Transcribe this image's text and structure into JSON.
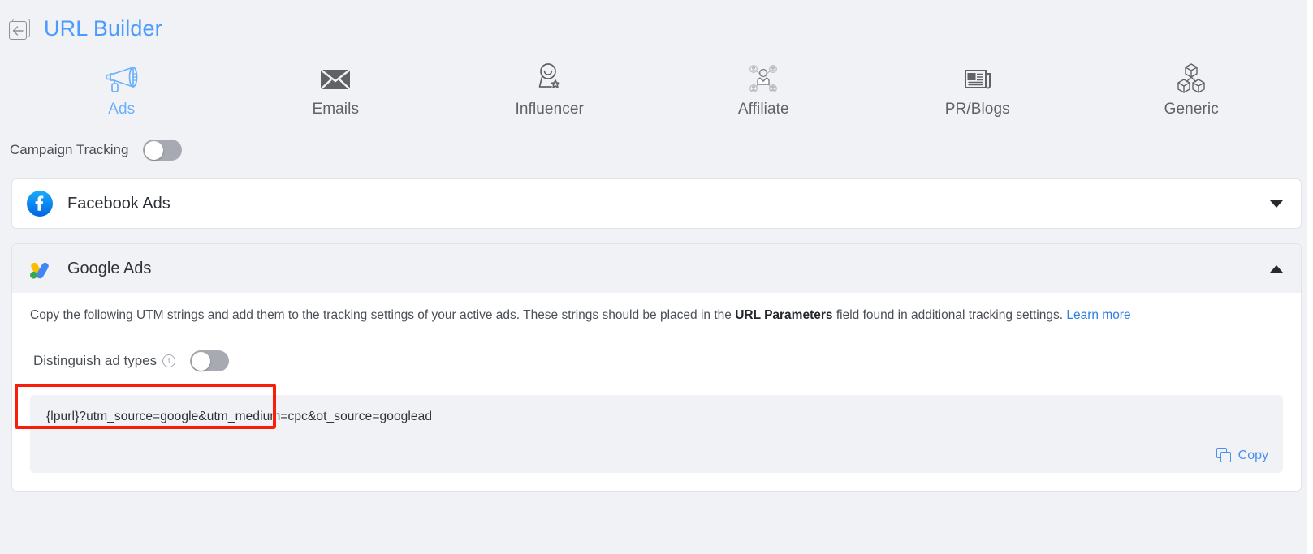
{
  "header": {
    "back_icon": "back-arrow-icon",
    "title": "URL Builder"
  },
  "tabs": [
    {
      "label": "Ads",
      "icon": "megaphone-icon",
      "active": true
    },
    {
      "label": "Emails",
      "icon": "envelope-icon",
      "active": false
    },
    {
      "label": "Influencer",
      "icon": "influencer-person-star-icon",
      "active": false
    },
    {
      "label": "Affiliate",
      "icon": "affiliate-network-icon",
      "active": false
    },
    {
      "label": "PR/Blogs",
      "icon": "newspaper-icon",
      "active": false
    },
    {
      "label": "Generic",
      "icon": "cubes-icon",
      "active": false
    }
  ],
  "campaign_tracking": {
    "label": "Campaign Tracking",
    "state": "off"
  },
  "channels": [
    {
      "title": "Facebook Ads",
      "icon": "facebook-logo",
      "expanded": false,
      "chevron": "chevron-down-icon"
    },
    {
      "title": "Google Ads",
      "icon": "google-ads-logo",
      "expanded": true,
      "chevron": "chevron-up-icon"
    }
  ],
  "google_ads": {
    "desc_part1": "Copy the following UTM strings and add them to the tracking settings of your active ads. These strings should be placed in the ",
    "desc_bold": "URL Parameters",
    "desc_part2": " field found in additional tracking settings. ",
    "desc_link": "Learn more",
    "distinguish_label": "Distinguish ad types",
    "distinguish_info_icon": "info-icon",
    "distinguish_state": "off",
    "utm_string": "{lpurl}?utm_source=google&utm_medium=cpc&ot_source=googlead",
    "copy_label": "Copy",
    "copy_icon": "copy-icon"
  },
  "colors": {
    "accent_blue": "#4b9bff",
    "link_blue": "#2f7fe0",
    "highlight_red": "#f91e09",
    "page_bg": "#f1f2f6",
    "text_dark": "#2d3238"
  }
}
